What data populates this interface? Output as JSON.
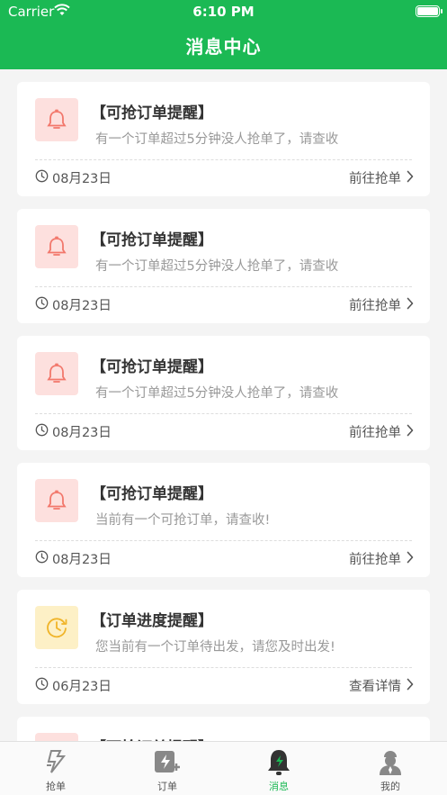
{
  "status_bar": {
    "carrier": "Carrier",
    "time": "6:10 PM"
  },
  "header": {
    "title": "消息中心"
  },
  "messages": [
    {
      "type": "bell",
      "color": "#f2776b",
      "title": "【可抢订单提醒】",
      "desc": "有一个订单超过5分钟没人抢单了，请查收",
      "date": "08月23日",
      "action": "前往抢单"
    },
    {
      "type": "bell",
      "color": "#f2776b",
      "title": "【可抢订单提醒】",
      "desc": "有一个订单超过5分钟没人抢单了，请查收",
      "date": "08月23日",
      "action": "前往抢单"
    },
    {
      "type": "bell",
      "color": "#f2776b",
      "title": "【可抢订单提醒】",
      "desc": "有一个订单超过5分钟没人抢单了，请查收",
      "date": "08月23日",
      "action": "前往抢单"
    },
    {
      "type": "bell",
      "color": "#f2776b",
      "title": "【可抢订单提醒】",
      "desc": "当前有一个可抢订单，请查收!",
      "date": "08月23日",
      "action": "前往抢单"
    },
    {
      "type": "clock",
      "color": "#f0b429",
      "title": "【订单进度提醒】",
      "desc": "您当前有一个订单待出发，请您及时出发!",
      "date": "06月23日",
      "action": "查看详情"
    },
    {
      "type": "bell",
      "color": "#f2776b",
      "title": "【可抢订单提醒】",
      "desc": "",
      "date": "",
      "action": ""
    }
  ],
  "tabs": [
    {
      "label": "抢单",
      "icon": "grab-order-icon",
      "active": false
    },
    {
      "label": "订单",
      "icon": "order-icon",
      "active": false
    },
    {
      "label": "消息",
      "icon": "message-bell-icon",
      "active": true
    },
    {
      "label": "我的",
      "icon": "profile-icon",
      "active": false
    }
  ],
  "colors": {
    "brand": "#1bb954",
    "alert_red": "#f2776b",
    "alert_yellow": "#f0b429"
  }
}
